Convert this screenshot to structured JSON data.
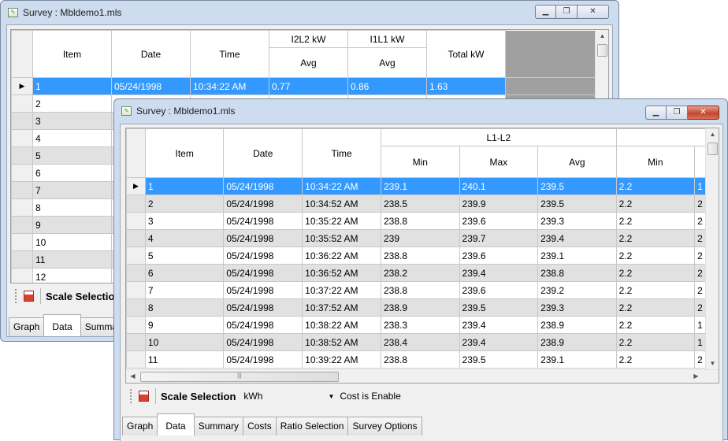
{
  "back_window": {
    "title": "Survey : Mbldemo1.mls",
    "columns": {
      "item": "Item",
      "date": "Date",
      "time": "Time",
      "i2l2": "I2L2 kW",
      "i1l1": "I1L1 kW",
      "avg": "Avg",
      "total": "Total kW"
    },
    "selected_row": {
      "item": "1",
      "date": "05/24/1998",
      "time": "10:34:22 AM",
      "i2l2_avg": "0.77",
      "i1l1_avg": "0.86",
      "total": "1.63"
    },
    "row_items": [
      "2",
      "3",
      "4",
      "5",
      "6",
      "7",
      "8",
      "9",
      "10",
      "11",
      "12"
    ],
    "toolbar": {
      "scale_label": "Scale Selection"
    },
    "tabs": [
      "Graph",
      "Data",
      "Summary"
    ]
  },
  "front_window": {
    "title": "Survey : Mbldemo1.mls",
    "columns": {
      "item": "Item",
      "date": "Date",
      "time": "Time",
      "group": "L1-L2",
      "min": "Min",
      "max": "Max",
      "avg": "Avg",
      "min2": "Min"
    },
    "rows": [
      {
        "item": "1",
        "date": "05/24/1998",
        "time": "10:34:22 AM",
        "min": "239.1",
        "max": "240.1",
        "avg": "239.5",
        "min2": "2.2",
        "more": "1"
      },
      {
        "item": "2",
        "date": "05/24/1998",
        "time": "10:34:52 AM",
        "min": "238.5",
        "max": "239.9",
        "avg": "239.5",
        "min2": "2.2",
        "more": "2"
      },
      {
        "item": "3",
        "date": "05/24/1998",
        "time": "10:35:22 AM",
        "min": "238.8",
        "max": "239.6",
        "avg": "239.3",
        "min2": "2.2",
        "more": "2"
      },
      {
        "item": "4",
        "date": "05/24/1998",
        "time": "10:35:52 AM",
        "min": "239",
        "max": "239.7",
        "avg": "239.4",
        "min2": "2.2",
        "more": "2"
      },
      {
        "item": "5",
        "date": "05/24/1998",
        "time": "10:36:22 AM",
        "min": "238.8",
        "max": "239.6",
        "avg": "239.1",
        "min2": "2.2",
        "more": "2"
      },
      {
        "item": "6",
        "date": "05/24/1998",
        "time": "10:36:52 AM",
        "min": "238.2",
        "max": "239.4",
        "avg": "238.8",
        "min2": "2.2",
        "more": "2"
      },
      {
        "item": "7",
        "date": "05/24/1998",
        "time": "10:37:22 AM",
        "min": "238.8",
        "max": "239.6",
        "avg": "239.2",
        "min2": "2.2",
        "more": "2"
      },
      {
        "item": "8",
        "date": "05/24/1998",
        "time": "10:37:52 AM",
        "min": "238.9",
        "max": "239.5",
        "avg": "239.3",
        "min2": "2.2",
        "more": "2"
      },
      {
        "item": "9",
        "date": "05/24/1998",
        "time": "10:38:22 AM",
        "min": "238.3",
        "max": "239.4",
        "avg": "238.9",
        "min2": "2.2",
        "more": "1"
      },
      {
        "item": "10",
        "date": "05/24/1998",
        "time": "10:38:52 AM",
        "min": "238.4",
        "max": "239.4",
        "avg": "238.9",
        "min2": "2.2",
        "more": "1"
      },
      {
        "item": "11",
        "date": "05/24/1998",
        "time": "10:39:22 AM",
        "min": "238.8",
        "max": "239.5",
        "avg": "239.1",
        "min2": "2.2",
        "more": "2"
      }
    ],
    "toolbar": {
      "scale_label": "Scale Selection",
      "scale_value": "kWh",
      "cost_label": "Cost is Enable"
    },
    "tabs": [
      "Graph",
      "Data",
      "Summary",
      "Costs",
      "Ratio Selection",
      "Survey Options"
    ],
    "active_tab": "Data"
  },
  "icons": {
    "minimize": "minimize-icon",
    "maximize": "maximize-icon",
    "close": "close-icon"
  },
  "colors": {
    "selection": "#3399ff",
    "alt_row": "#e1e1e1",
    "close_button": "#c6462e"
  }
}
